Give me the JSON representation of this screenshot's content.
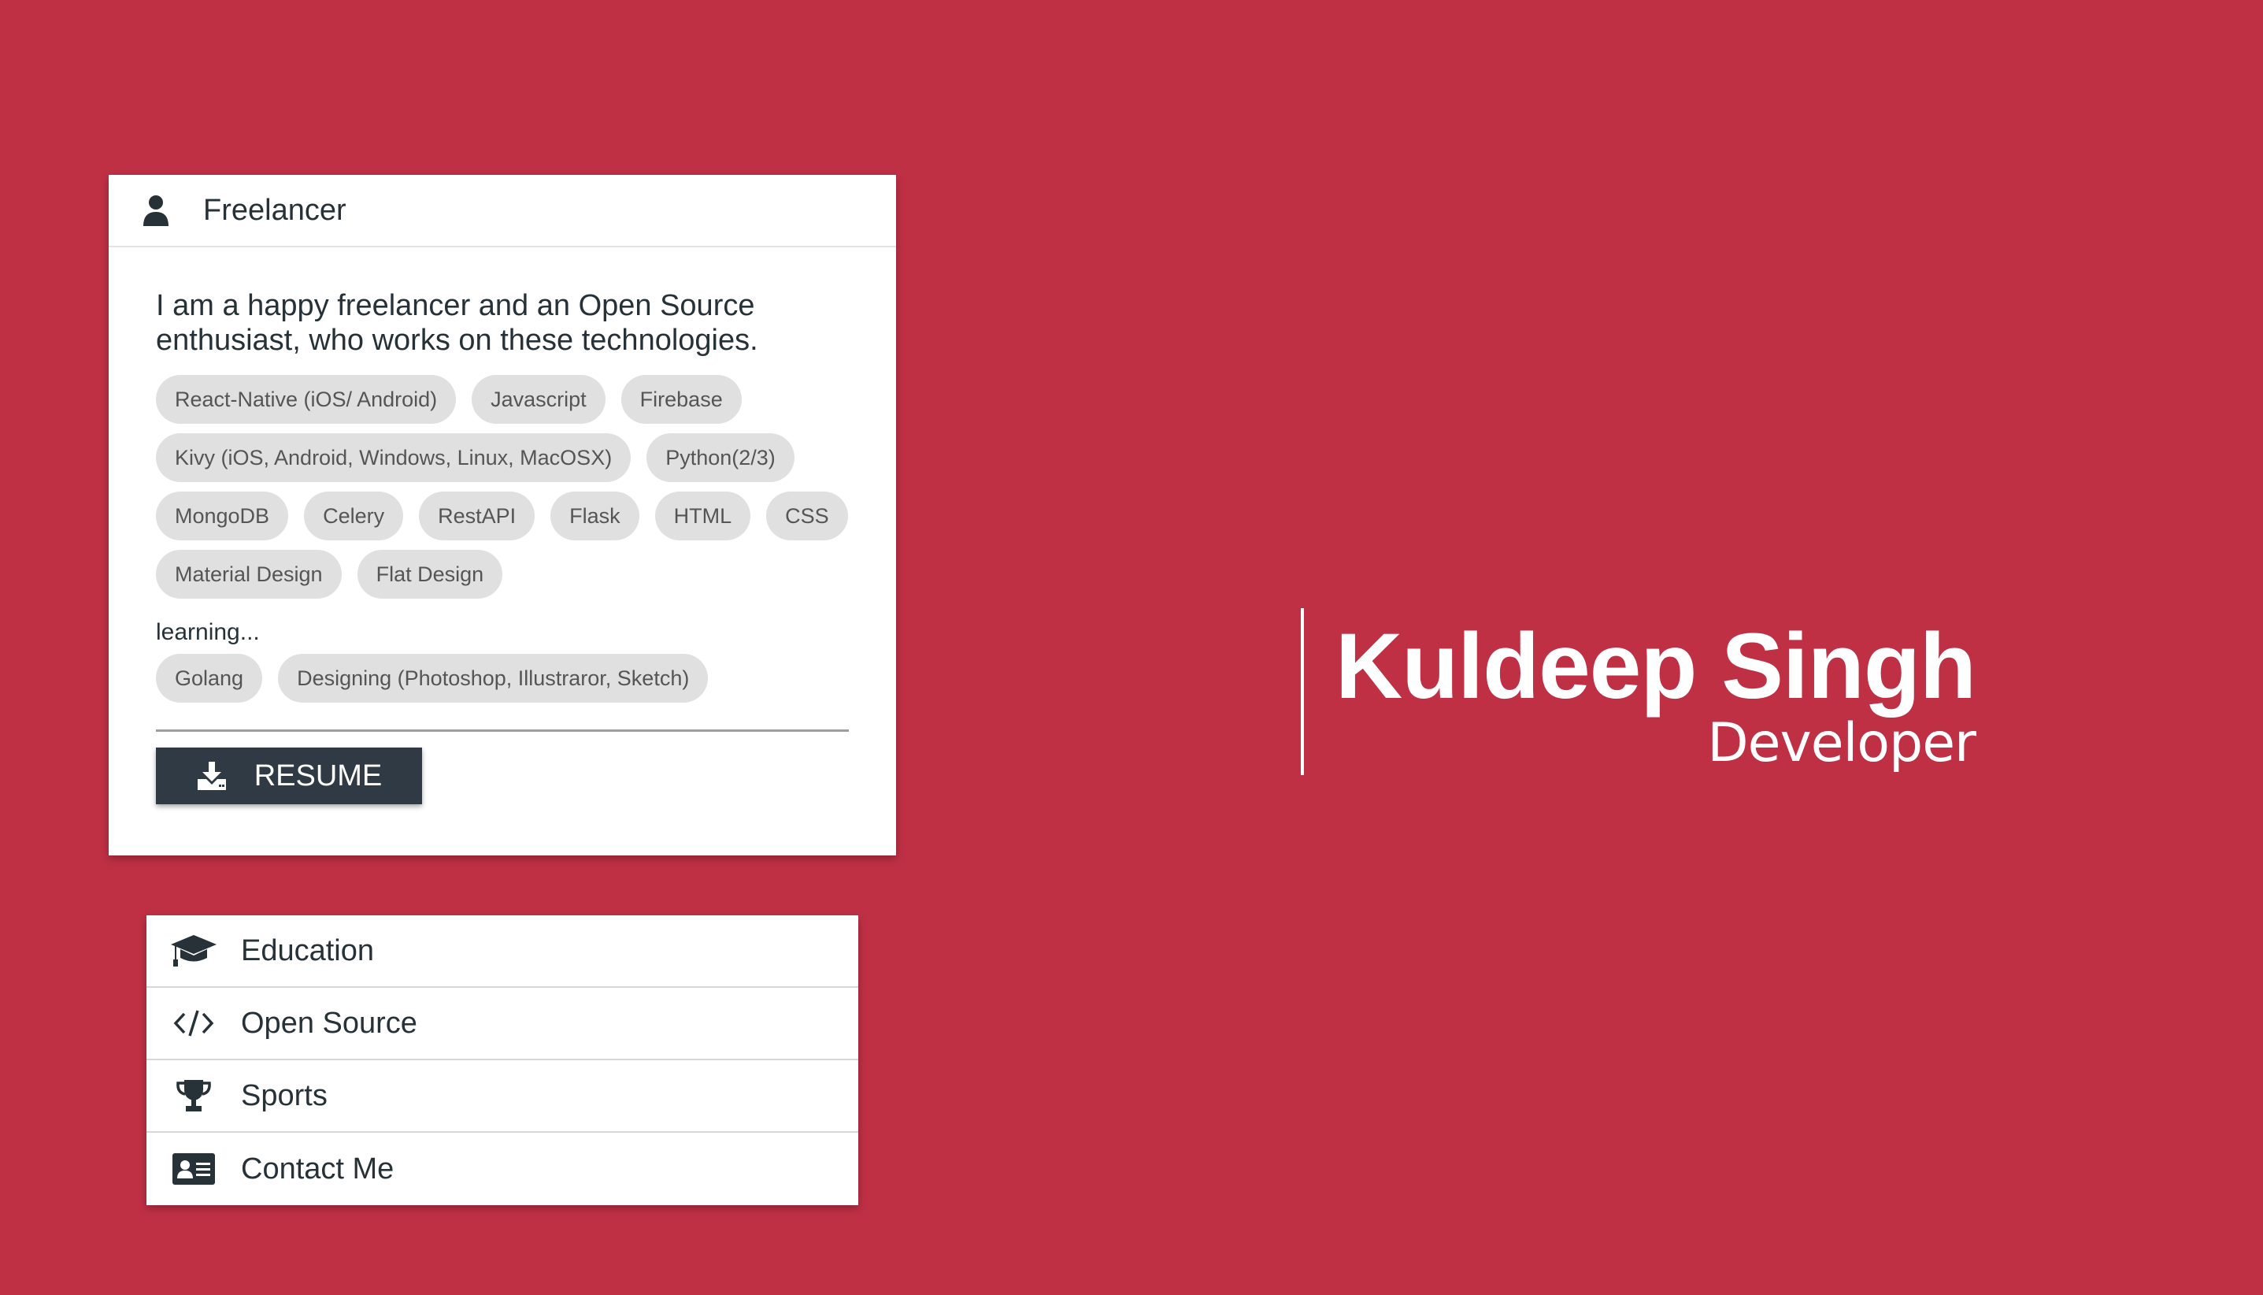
{
  "profile_card": {
    "header_icon": "user-icon",
    "title": "Freelancer",
    "intro": "I am a happy freelancer and an Open Source enthusiast, who works on these technologies.",
    "skills": [
      "React-Native (iOS/ Android)",
      "Javascript",
      "Firebase",
      "Kivy (iOS, Android, Windows, Linux, MacOSX)",
      "Python(2/3)",
      "MongoDB",
      "Celery",
      "RestAPI",
      "Flask",
      "HTML",
      "CSS",
      "Material Design",
      "Flat Design"
    ],
    "learning_label": "learning...",
    "learning": [
      "Golang",
      "Designing (Photoshop, Illustraror, Sketch)"
    ],
    "resume_button": {
      "icon": "download-icon",
      "label": "RESUME"
    }
  },
  "menu": {
    "items": [
      {
        "icon": "graduation-cap-icon",
        "label": "Education"
      },
      {
        "icon": "code-icon",
        "label": "Open Source"
      },
      {
        "icon": "trophy-icon",
        "label": "Sports"
      },
      {
        "icon": "contact-card-icon",
        "label": "Contact Me"
      }
    ]
  },
  "hero": {
    "name": "Kuldeep Singh",
    "role": "Developer"
  },
  "colors": {
    "background": "#bf3045",
    "card": "#ffffff",
    "text_dark": "#263238",
    "chip_bg": "#e0e0e0",
    "button_bg": "#2f3a45"
  }
}
